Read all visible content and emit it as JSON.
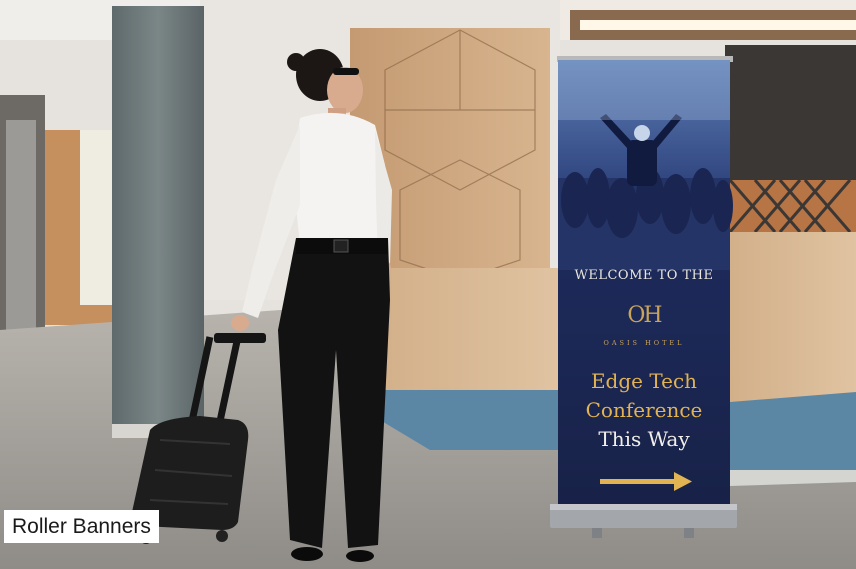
{
  "caption": {
    "label": "Roller Banners"
  },
  "banner": {
    "welcome": "WELCOME TO THE",
    "logo": "OH",
    "hotel": "OASIS HOTEL",
    "line1": "Edge Tech",
    "line2": "Conference",
    "line3": "This Way"
  },
  "colors": {
    "banner_navy": "#1d2a5a",
    "banner_gold": "#e2b352",
    "wood": "#c9a27a",
    "floor": "#a9a59f"
  }
}
